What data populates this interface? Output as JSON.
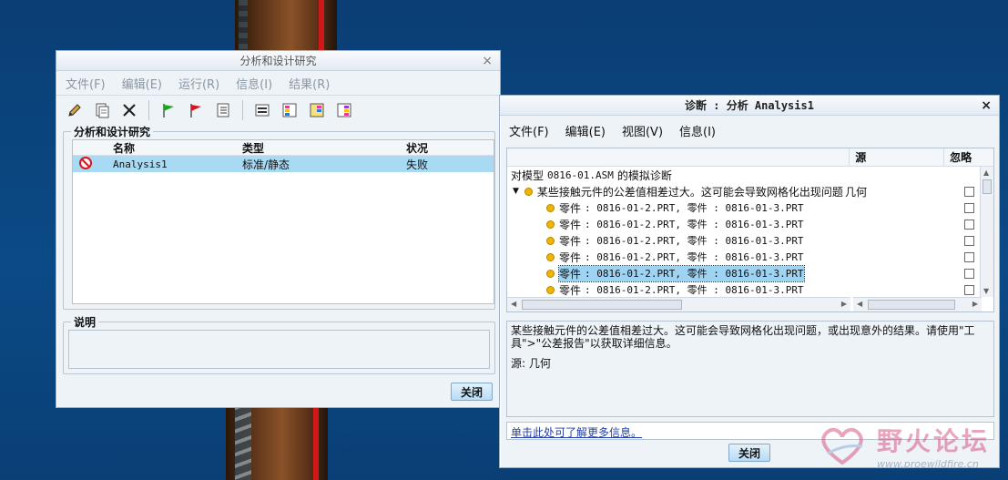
{
  "left_window": {
    "title": "分析和设计研究",
    "menu": [
      "文件(F)",
      "编辑(E)",
      "运行(R)",
      "信息(I)",
      "结果(R)"
    ],
    "toolbar_icons": [
      "pencil-icon",
      "new-document-icon",
      "delete-x-icon",
      "green-flag-icon",
      "red-flag-icon",
      "list-icon",
      "report-icon",
      "color-results-icon",
      "yellow-results-icon",
      "purple-results-icon"
    ],
    "studies_group_label": "分析和设计研究",
    "columns": {
      "name": "名称",
      "type": "类型",
      "status": "状况"
    },
    "rows": [
      {
        "name": "Analysis1",
        "type": "标准/静态",
        "status": "失败"
      }
    ],
    "desc_group_label": "说明",
    "close_label": "关闭"
  },
  "right_window": {
    "title": "诊断 : 分析 Analysis1",
    "menu": [
      "文件(F)",
      "编辑(E)",
      "视图(V)",
      "信息(I)"
    ],
    "columns": {
      "source": "源",
      "ignore": "忽略"
    },
    "root_prefix": "对模型",
    "root_model": "0816-01.ASM",
    "root_suffix": "的模拟诊断",
    "issue_text": "某些接触元件的公差值相差过大。这可能会导致网格化出现问题",
    "issue_source": "几何",
    "part_lines": [
      {
        "label": "零件",
        "text": ": 0816-01-2.PRT, 零件 : 0816-01-3.PRT"
      },
      {
        "label": "零件",
        "text": ": 0816-01-2.PRT, 零件 : 0816-01-3.PRT"
      },
      {
        "label": "零件",
        "text": ": 0816-01-2.PRT, 零件 : 0816-01-3.PRT"
      },
      {
        "label": "零件",
        "text": ": 0816-01-2.PRT, 零件 : 0816-01-3.PRT"
      },
      {
        "label": "零件",
        "text": ": 0816-01-2.PRT, 零件 : 0816-01-3.PRT"
      },
      {
        "label": "零件",
        "text": ": 0816-01-2.PRT, 零件 : 0816-01-3.PRT"
      }
    ],
    "selected_line_index": 4,
    "description": "某些接触元件的公差值相差过大。这可能会导致网格化出现问题，或出现意外的结果。请使用\"工具\">\"公差报告\"以获取详细信息。",
    "source_line": "源: 几何",
    "more_info_link": "单击此处可了解更多信息。",
    "close_label": "关闭"
  },
  "watermark": {
    "title": "野火论坛",
    "url": "www.proewildfire.cn"
  },
  "colors": {
    "selection": "#a9daf4",
    "warning_dot": "#f1b400",
    "button_top": "#e4f2fc",
    "link": "#1f3fa6"
  }
}
